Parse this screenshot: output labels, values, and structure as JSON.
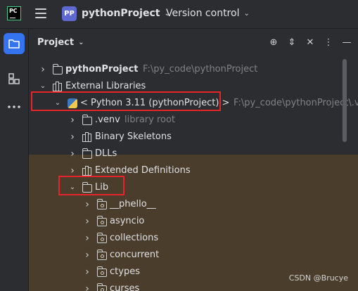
{
  "titlebar": {
    "logo_text": "PC",
    "project_badge": "PP",
    "project_name": "pythonProject",
    "vcs_label": "Version control"
  },
  "panel": {
    "title": "Project"
  },
  "tree": [
    {
      "indent": 0,
      "arrow": "right",
      "icon": "folder-icon",
      "label": "pythonProject",
      "label_bold": true,
      "secondary": "F:\\py_code\\pythonProject"
    },
    {
      "indent": 0,
      "arrow": "down",
      "icon": "libraries-icon",
      "label": "External Libraries",
      "label_bold": false,
      "secondary": ""
    },
    {
      "indent": 1,
      "arrow": "down",
      "icon": "python-icon",
      "label": "< Python 3.11 (pythonProject) >",
      "label_bold": false,
      "secondary": "F:\\py_code\\pythonProject\\.v"
    },
    {
      "indent": 2,
      "arrow": "right",
      "icon": "folder-icon",
      "label": ".venv",
      "label_bold": false,
      "secondary": "library root"
    },
    {
      "indent": 2,
      "arrow": "right",
      "icon": "libraries-icon",
      "label": "Binary Skeletons",
      "label_bold": false,
      "secondary": ""
    },
    {
      "indent": 2,
      "arrow": "right",
      "icon": "folder-icon",
      "label": "DLLs",
      "label_bold": false,
      "secondary": ""
    },
    {
      "indent": 2,
      "arrow": "right",
      "icon": "libraries-icon",
      "label": "Extended Definitions",
      "label_bold": false,
      "secondary": ""
    },
    {
      "indent": 2,
      "arrow": "down",
      "icon": "folder-icon",
      "label": "Lib",
      "label_bold": false,
      "secondary": ""
    },
    {
      "indent": 3,
      "arrow": "right",
      "icon": "package-folder-icon",
      "label": "__phello__",
      "label_bold": false,
      "secondary": ""
    },
    {
      "indent": 3,
      "arrow": "right",
      "icon": "package-folder-icon",
      "label": "asyncio",
      "label_bold": false,
      "secondary": ""
    },
    {
      "indent": 3,
      "arrow": "right",
      "icon": "package-folder-icon",
      "label": "collections",
      "label_bold": false,
      "secondary": ""
    },
    {
      "indent": 3,
      "arrow": "right",
      "icon": "package-folder-icon",
      "label": "concurrent",
      "label_bold": false,
      "secondary": ""
    },
    {
      "indent": 3,
      "arrow": "right",
      "icon": "package-folder-icon",
      "label": "ctypes",
      "label_bold": false,
      "secondary": ""
    },
    {
      "indent": 3,
      "arrow": "right",
      "icon": "package-folder-icon",
      "label": "curses",
      "label_bold": false,
      "secondary": ""
    }
  ],
  "watermark": "CSDN @Brucye",
  "colors": {
    "accent": "#3574f0",
    "highlight_box": "#e8242b",
    "library_background": "#4b3d2b"
  }
}
